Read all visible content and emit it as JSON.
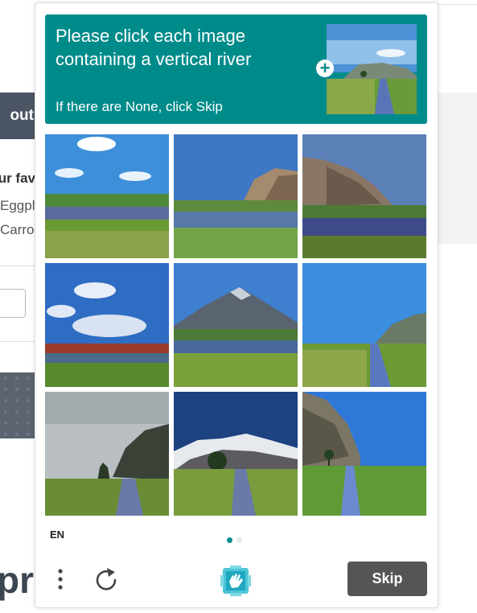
{
  "background_page": {
    "tab_label": "out",
    "question_fragment": "ur fav",
    "option_1_fragment": "Eggpl",
    "option_2_fragment": "Carro",
    "heading_fragment": "pri"
  },
  "captcha": {
    "prompt": "Please click each image containing a vertical river",
    "hint": "If there are None, click Skip",
    "language": "EN",
    "skip_label": "Skip",
    "accent_color": "#008b8b",
    "example_icon": "plus-circle-icon",
    "images": [
      {
        "scene": "horizontal-river-grassland"
      },
      {
        "scene": "horizontal-river-cliff"
      },
      {
        "scene": "horizontal-river-mountain-cliff"
      },
      {
        "scene": "horizontal-river-cloudy-sky"
      },
      {
        "scene": "horizontal-river-mountain"
      },
      {
        "scene": "vertical-river-cliff"
      },
      {
        "scene": "vertical-river-overcast-tree"
      },
      {
        "scene": "vertical-river-snow-mountain"
      },
      {
        "scene": "vertical-river-rocky-cliff"
      }
    ],
    "pagination": {
      "current": 1,
      "total": 2
    },
    "icons": {
      "menu": "vertical-dots-icon",
      "refresh": "refresh-icon",
      "logo": "hcaptcha-hand-logo"
    }
  }
}
